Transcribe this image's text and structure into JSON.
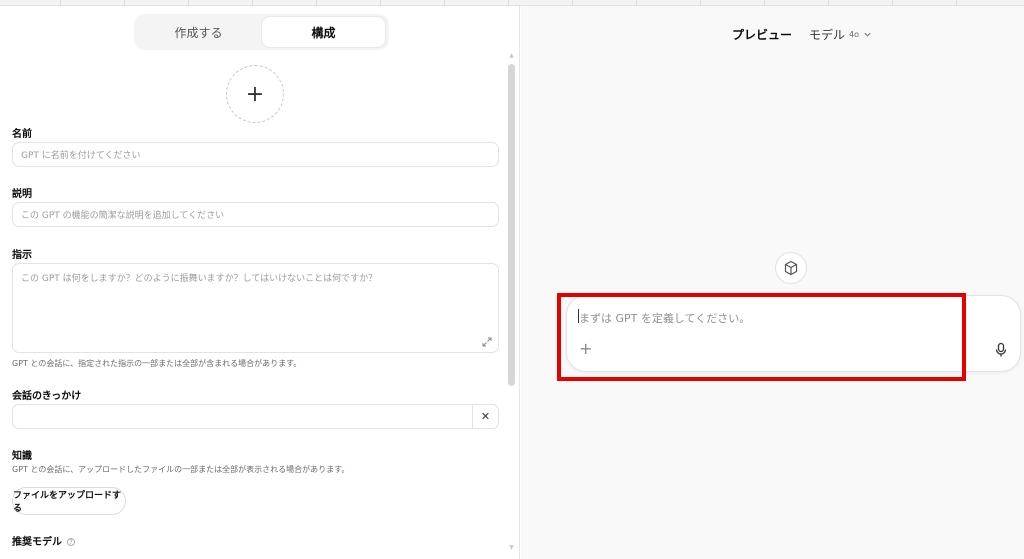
{
  "tabs": {
    "create": "作成する",
    "configure": "構成"
  },
  "form": {
    "name_label": "名前",
    "name_placeholder": "GPT に名前を付けてください",
    "description_label": "説明",
    "description_placeholder": "この GPT の機能の簡潔な説明を追加してください",
    "instructions_label": "指示",
    "instructions_placeholder": "この GPT は何をしますか？どのように振舞いますか？してはいけないことは何ですか？",
    "instructions_help": "GPT との会話に、指定された指示の一部または全部が含まれる場合があります。",
    "starters_label": "会話のきっかけ",
    "knowledge_label": "知識",
    "knowledge_help": "GPT との会話に、アップロードしたファイルの一部または全部が表示される場合があります。",
    "upload_button": "ファイルをアップロードする",
    "recommended_model_label": "推奨モデル"
  },
  "preview": {
    "title": "プレビュー",
    "model_label": "モデル",
    "model_version": "4o",
    "input_placeholder": "まずは GPT を定義してください。"
  },
  "icons": {
    "add_avatar": "plus-icon",
    "expand": "expand-icon",
    "clear": "close-icon",
    "chevron": "chevron-down-icon",
    "gpt": "cube-icon",
    "attach": "plus-icon",
    "mic": "microphone-icon",
    "info": "info-icon"
  },
  "colors": {
    "highlight": "#e50000",
    "panel_bg": "#f9f9f9"
  }
}
